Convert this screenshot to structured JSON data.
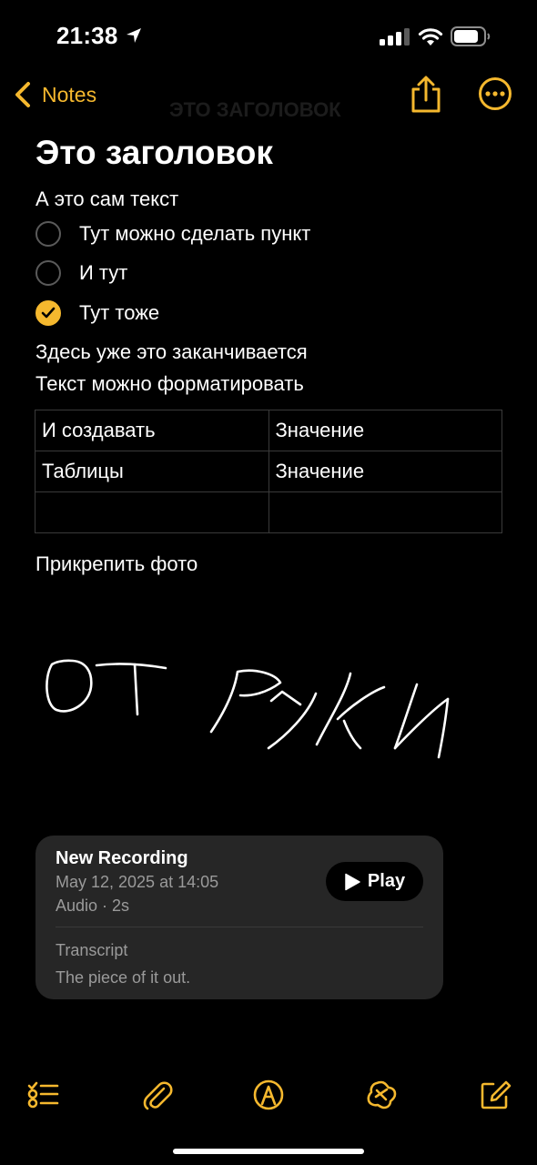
{
  "status_bar": {
    "time": "21:38"
  },
  "nav": {
    "back_label": "Notes",
    "ghost_title": "ЭТО ЗАГОЛОВОК"
  },
  "note": {
    "title": "Это заголовок",
    "body_line": "А это сам текст",
    "checklist": [
      {
        "label": "Тут можно сделать пункт",
        "checked": false
      },
      {
        "label": "И тут",
        "checked": false
      },
      {
        "label": "Тут тоже",
        "checked": true
      }
    ],
    "line_after_1": "Здесь уже это заканчивается",
    "line_after_2": "Текст можно форматировать",
    "table": [
      [
        "И создавать",
        "Значение"
      ],
      [
        "Таблицы",
        "Значение"
      ],
      [
        "",
        ""
      ]
    ],
    "attach_line": "Прикрепить фото"
  },
  "recording": {
    "title": "New Recording",
    "date": "May 12, 2025 at 14:05",
    "meta": "Audio · 2s",
    "play_label": "Play",
    "transcript_label": "Transcript",
    "transcript_text": "The piece of it out."
  },
  "colors": {
    "accent": "#F5B82E",
    "background": "#000000",
    "card": "#262626",
    "secondary_text": "#9a9a9a"
  },
  "icons": {
    "status": [
      "location-arrow-icon",
      "cellular-signal-icon",
      "wifi-icon",
      "battery-icon"
    ],
    "nav": [
      "chevron-left-icon",
      "share-icon",
      "more-ellipsis-icon"
    ],
    "toolbar": [
      "checklist-icon",
      "paperclip-icon",
      "markup-pen-icon",
      "apple-intelligence-icon",
      "compose-icon"
    ]
  }
}
